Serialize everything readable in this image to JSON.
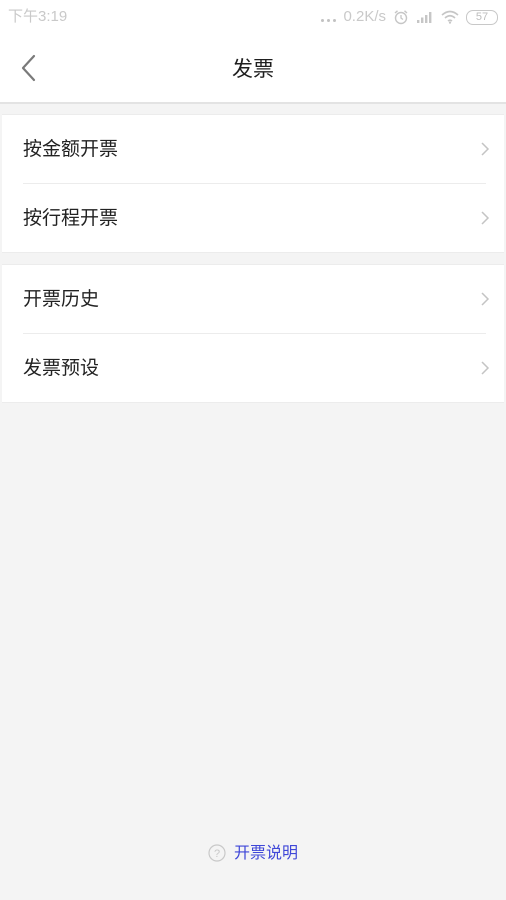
{
  "status_bar": {
    "time": "下午3:19",
    "network_speed": "0.2K/s",
    "battery_level": "57",
    "icons": [
      "more-dots-icon",
      "alarm-icon",
      "signal-icon",
      "wifi-icon",
      "battery-icon"
    ]
  },
  "nav": {
    "title": "发票",
    "back_icon": "chevron-left-icon"
  },
  "groups": [
    {
      "items": [
        {
          "label": "按金额开票",
          "icon": "chevron-right-icon"
        },
        {
          "label": "按行程开票",
          "icon": "chevron-right-icon"
        }
      ]
    },
    {
      "items": [
        {
          "label": "开票历史",
          "icon": "chevron-right-icon"
        },
        {
          "label": "发票预设",
          "icon": "chevron-right-icon"
        }
      ]
    }
  ],
  "footer": {
    "link_label": "开票说明",
    "icon": "question-circle-icon"
  },
  "colors": {
    "background": "#f4f4f4",
    "surface": "#ffffff",
    "text_primary": "#222222",
    "link": "#3f47d8",
    "chevron": "#c4c4c4",
    "status_text": "#c9c9c9"
  }
}
